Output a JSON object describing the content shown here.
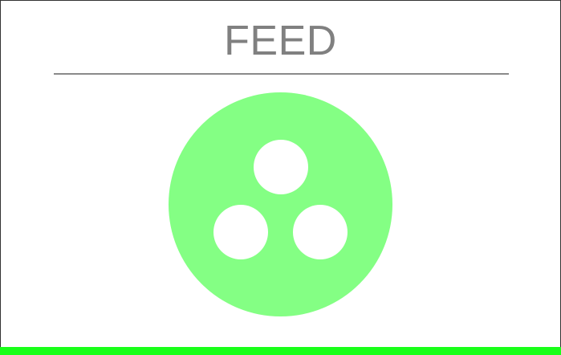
{
  "header": {
    "title": "FEED"
  },
  "feed_button": {
    "icon": "feed-pellets-icon",
    "color": "#84ff84",
    "hole_color": "#ffffff"
  },
  "status_bar": {
    "color": "#19ff19"
  }
}
